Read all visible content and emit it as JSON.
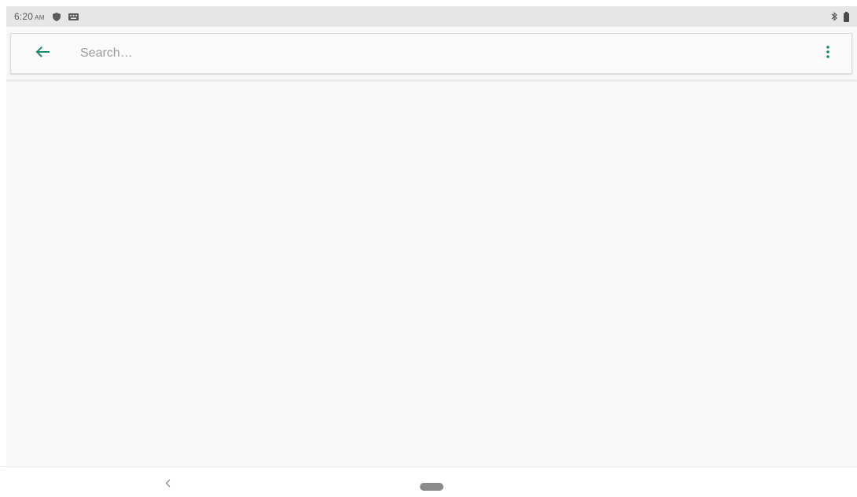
{
  "status_bar": {
    "time": "6:20",
    "ampm": "AM",
    "icons": [
      "shield-icon",
      "keyboard-icon",
      "bluetooth-icon",
      "battery-icon"
    ]
  },
  "search": {
    "placeholder": "Search…",
    "value": "",
    "back_icon": "arrow-left-icon",
    "menu_icon": "more-vertical-icon"
  },
  "nav_bar": {
    "back_icon": "chevron-left-icon",
    "home_icon": "home-pill-icon"
  },
  "colors": {
    "accent": "#1a8a6a",
    "status_bar_bg": "#e6e6e6",
    "content_bg": "#f8f8f8"
  }
}
